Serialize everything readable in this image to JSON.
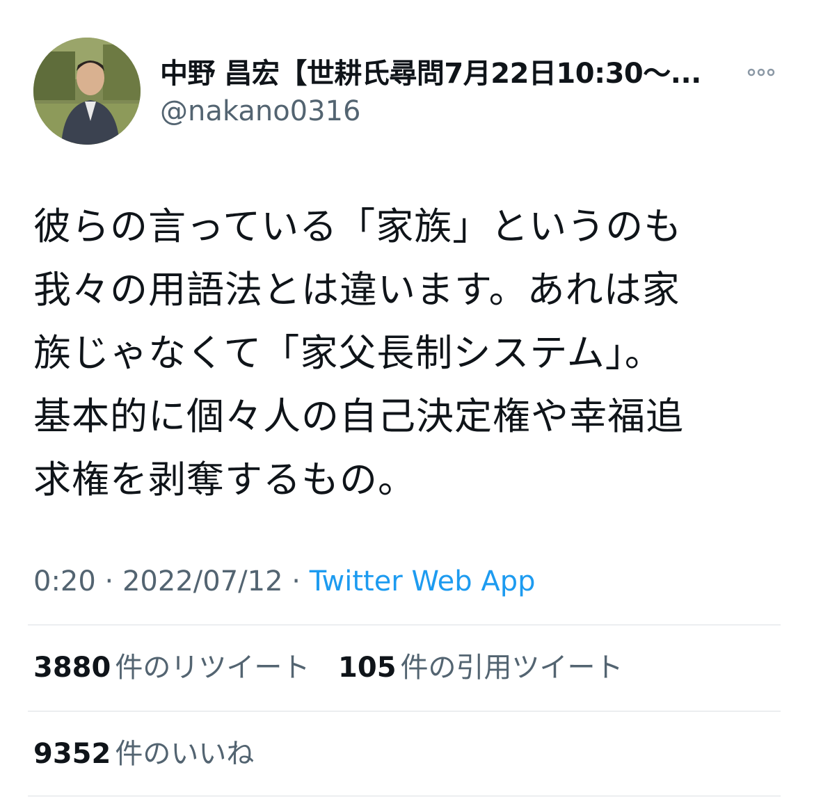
{
  "author": {
    "display_name": "中野 昌宏【世耕氏尋問7月22日10:30〜...",
    "handle": "@nakano0316"
  },
  "icons": {
    "more": "more-horizontal-icon",
    "avatar": "profile-photo"
  },
  "tweet": {
    "text": "彼らの言っている「家族」というのも\n我々の用語法とは違います。あれは家\n族じゃなくて「家父長制システム」。\n基本的に個々人の自己決定権や幸福追\n求権を剥奪するもの。",
    "time": "0:20",
    "separator": "·",
    "date": "2022/07/12",
    "source": "Twitter Web App"
  },
  "stats": {
    "retweets": {
      "count": "3880",
      "label": "件のリツイート"
    },
    "quotes": {
      "count": "105",
      "label": "件の引用ツイート"
    },
    "likes": {
      "count": "9352",
      "label": "件のいいね"
    }
  },
  "colors": {
    "text": "#0f1419",
    "secondary": "#536471",
    "link": "#1d9bf0",
    "divider": "#dcdfe3"
  }
}
